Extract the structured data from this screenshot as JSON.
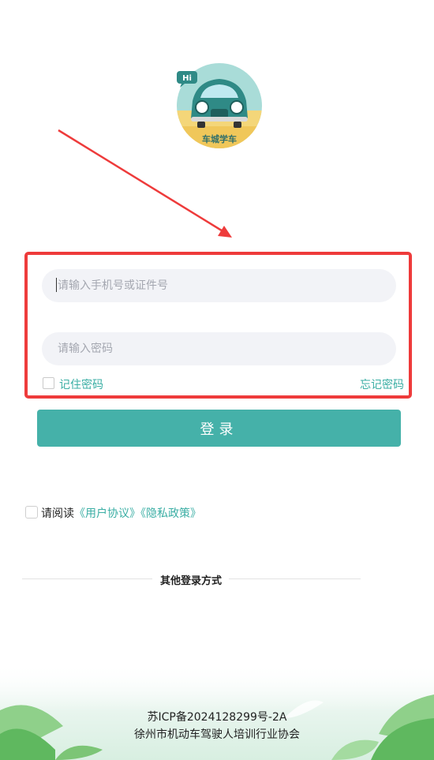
{
  "logo": {
    "badge": "Hi",
    "brand_text": "车城学车"
  },
  "form": {
    "phone_placeholder": "请输入手机号或证件号",
    "password_placeholder": "请输入密码",
    "remember_label": "记住密码",
    "forgot_label": "忘记密码",
    "login_label": "登录"
  },
  "agreement": {
    "prefix": "请阅读",
    "user_agreement": "《用户协议》",
    "privacy_policy": "《隐私政策》"
  },
  "other_login": {
    "title": "其他登录方式"
  },
  "footer": {
    "icp": "苏ICP备2024128299号-2A",
    "org": "徐州市机动车驾驶人培训行业协会"
  },
  "colors": {
    "accent": "#45b1a9",
    "link": "#3aaea4",
    "highlight": "#ee3b3b",
    "input_bg": "#f2f3f7"
  }
}
